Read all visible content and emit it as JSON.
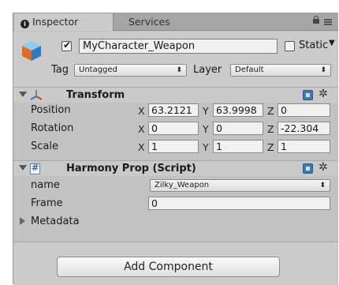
{
  "tabs": {
    "inspector_label": "Inspector",
    "services_label": "Services"
  },
  "game_object": {
    "active": true,
    "name": "MyCharacter_Weapon",
    "static_label": "Static",
    "static_checked": false,
    "tag_label": "Tag",
    "tag_value": "Untagged",
    "layer_label": "Layer",
    "layer_value": "Default"
  },
  "transform": {
    "title": "Transform",
    "rows": [
      {
        "label": "Position",
        "x": "63.2121",
        "y": "63.9998",
        "z": "0"
      },
      {
        "label": "Rotation",
        "x": "0",
        "y": "0",
        "z": "-22.304"
      },
      {
        "label": "Scale",
        "x": "1",
        "y": "1",
        "z": "1"
      }
    ],
    "axis_labels": [
      "X",
      "Y",
      "Z"
    ]
  },
  "script": {
    "title": "Harmony Prop (Script)",
    "name_label": "name",
    "name_value": "Zilky_Weapon",
    "frame_label": "Frame",
    "frame_value": "0",
    "metadata_label": "Metadata"
  },
  "add_component_label": "Add Component",
  "colors": {
    "panel_bg": "#c2c2c2",
    "header_bg": "#cbcbcb",
    "tab_bar": "#a5a5a5",
    "accent_blue": "#3d7ab5"
  }
}
